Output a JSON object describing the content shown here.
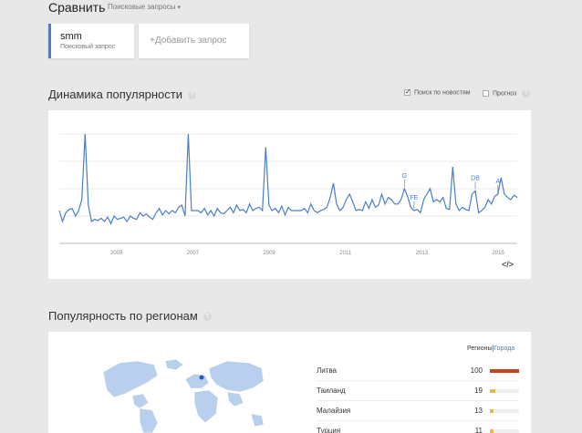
{
  "header": {
    "compare_label": "Сравнить",
    "dropdown_label": "Поисковые запросы"
  },
  "terms": [
    {
      "name": "smm",
      "sub": "Поисковый запрос",
      "color": "#4a7ec8"
    }
  ],
  "add_term_label": "+Добавить запрос",
  "interest": {
    "title": "Динамика популярности",
    "help": "?",
    "news_label": "Поиск по новостям",
    "forecast_label": "Прогноз",
    "news_checked": true,
    "forecast_checked": false,
    "embed_label": "</>"
  },
  "chart_data": {
    "type": "line",
    "series_color": "#4a7ec8",
    "x_ticks": [
      "2005",
      "2007",
      "2009",
      "2011",
      "2013",
      "2015"
    ],
    "x_start": 2004.0,
    "x_end": 2016.0,
    "ylim": [
      0,
      100
    ],
    "grid": true,
    "values": [
      30,
      20,
      28,
      31,
      32,
      25,
      30,
      40,
      100,
      35,
      20,
      22,
      21,
      23,
      20,
      24,
      18,
      25,
      22,
      23,
      24,
      20,
      25,
      23,
      22,
      28,
      25,
      27,
      24,
      22,
      28,
      32,
      26,
      30,
      27,
      30,
      28,
      33,
      35,
      25,
      100,
      30,
      30,
      30,
      28,
      32,
      26,
      30,
      25,
      32,
      28,
      27,
      30,
      33,
      28,
      35,
      30,
      31,
      28,
      36,
      30,
      32,
      33,
      30,
      88,
      35,
      30,
      32,
      28,
      34,
      26,
      33,
      30,
      30,
      30,
      30,
      32,
      28,
      36,
      30,
      28,
      30,
      31,
      33,
      42,
      55,
      36,
      30,
      33,
      40,
      45,
      38,
      30,
      31,
      30,
      38,
      32,
      40,
      33,
      35,
      45,
      36,
      42,
      40,
      36,
      36,
      40,
      50,
      43,
      33,
      30,
      31,
      28,
      40,
      45,
      50,
      38,
      40,
      38,
      42,
      32,
      31,
      70,
      36,
      30,
      33,
      31,
      30,
      45,
      48,
      28,
      30,
      33,
      40,
      36,
      43,
      45,
      60,
      45,
      42,
      40,
      44,
      42
    ],
    "annotations": [
      {
        "label": "G",
        "index": 107
      },
      {
        "label": "FE",
        "index": 110
      },
      {
        "label": "DB",
        "index": 129
      },
      {
        "label": "A",
        "index": 136
      }
    ]
  },
  "regions": {
    "title": "Популярность по регионам",
    "help": "?",
    "link_regions": "Регионы",
    "link_sep": "|",
    "link_cities": "Города",
    "rows": [
      {
        "name": "Литва",
        "value": "100",
        "fraction": 1.0
      },
      {
        "name": "Таиланд",
        "value": "19",
        "fraction": 0.19
      },
      {
        "name": "Малайзия",
        "value": "13",
        "fraction": 0.13
      },
      {
        "name": "Турция",
        "value": "11",
        "fraction": 0.11
      }
    ]
  }
}
